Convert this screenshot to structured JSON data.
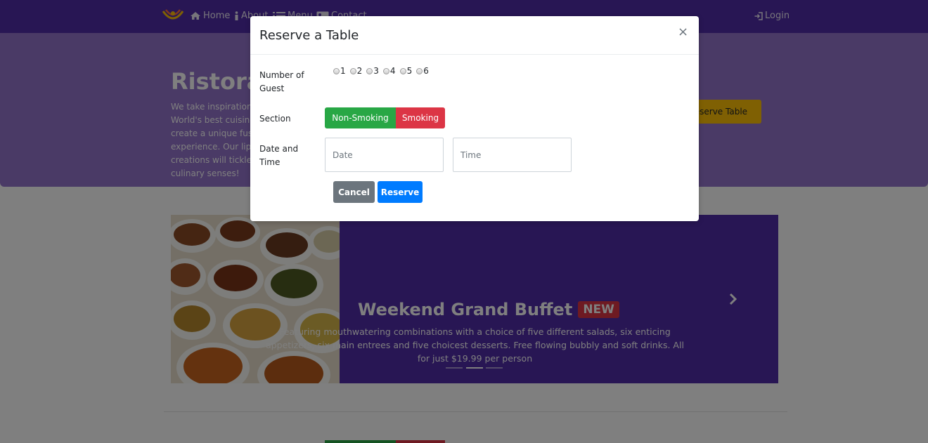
{
  "navbar": {
    "links": [
      {
        "label": "Home",
        "icon": "home-icon"
      },
      {
        "label": "About",
        "icon": "info-icon"
      },
      {
        "label": "Menu",
        "icon": "list-icon"
      },
      {
        "label": "Contact",
        "icon": "address-card-icon"
      }
    ],
    "login_label": "Login"
  },
  "jumbotron": {
    "title": "Ristorante con Fusion",
    "text": "We take inspiration from the World's best cuisines, and create a unique fusion experience. Our lipsmacking creations will tickle your culinary senses!",
    "reserve_label": "Reserve Table"
  },
  "carousel": {
    "slide_title": "Weekend Grand Buffet",
    "badge": "NEW",
    "description": "Featuring mouthwatering combinations with a choice of five different salads, six enticing appetizers, six main entrees and five choicest desserts. Free flowing bubbly and soft drinks. All for just $19.99 per person",
    "indicator_count": 3,
    "active_indicator": 2
  },
  "modal": {
    "title": "Reserve a Table",
    "close_label": "×",
    "guests_label": "Number of Guest",
    "guest_options": [
      "1",
      "2",
      "3",
      "4",
      "5",
      "6"
    ],
    "section_label": "Section",
    "section_options": [
      "Non-Smoking",
      "Smoking"
    ],
    "datetime_label": "Date and Time",
    "date_placeholder": "Date",
    "time_placeholder": "Time",
    "cancel_label": "Cancel",
    "reserve_label": "Reserve"
  },
  "colors": {
    "primary": "#512da8",
    "light_primary": "#9575cd",
    "accent": "#ffc107",
    "success": "#28a745",
    "danger": "#dc3545",
    "blue": "#007bff",
    "secondary": "#6c757d"
  }
}
